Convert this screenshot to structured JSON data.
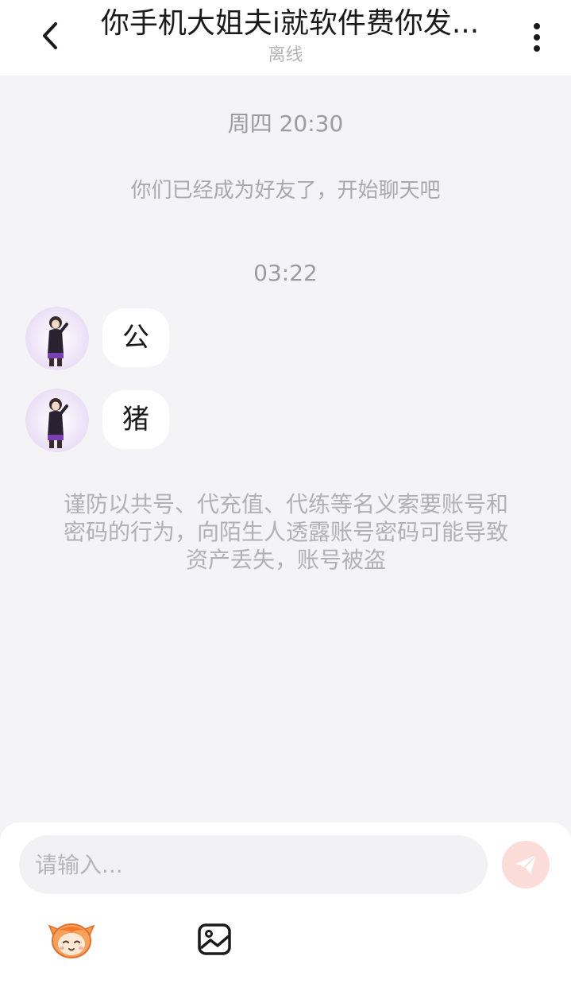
{
  "header": {
    "title": "你手机大姐夫i就软件费你发...",
    "status": "离线",
    "back_icon": "chevron-left-icon",
    "more_icon": "more-vertical-icon"
  },
  "chat": {
    "timestamp_1": "周四 20:30",
    "friend_note": "你们已经成为好友了，开始聊天吧",
    "timestamp_2": "03:22",
    "messages": [
      {
        "text": "公"
      },
      {
        "text": "猪"
      }
    ],
    "warning_lines": [
      "谨防以共号、代充值、代练等名义索要账号和",
      "密码的行为，向陌生人透露账号密码可能导致",
      "资产丢失，账号被盗"
    ]
  },
  "composer": {
    "placeholder": "请输入...",
    "send_icon": "send-icon",
    "emoji_icon": "emoji-sticker-icon",
    "image_icon": "image-icon",
    "send_color": "#fcdcd8"
  }
}
